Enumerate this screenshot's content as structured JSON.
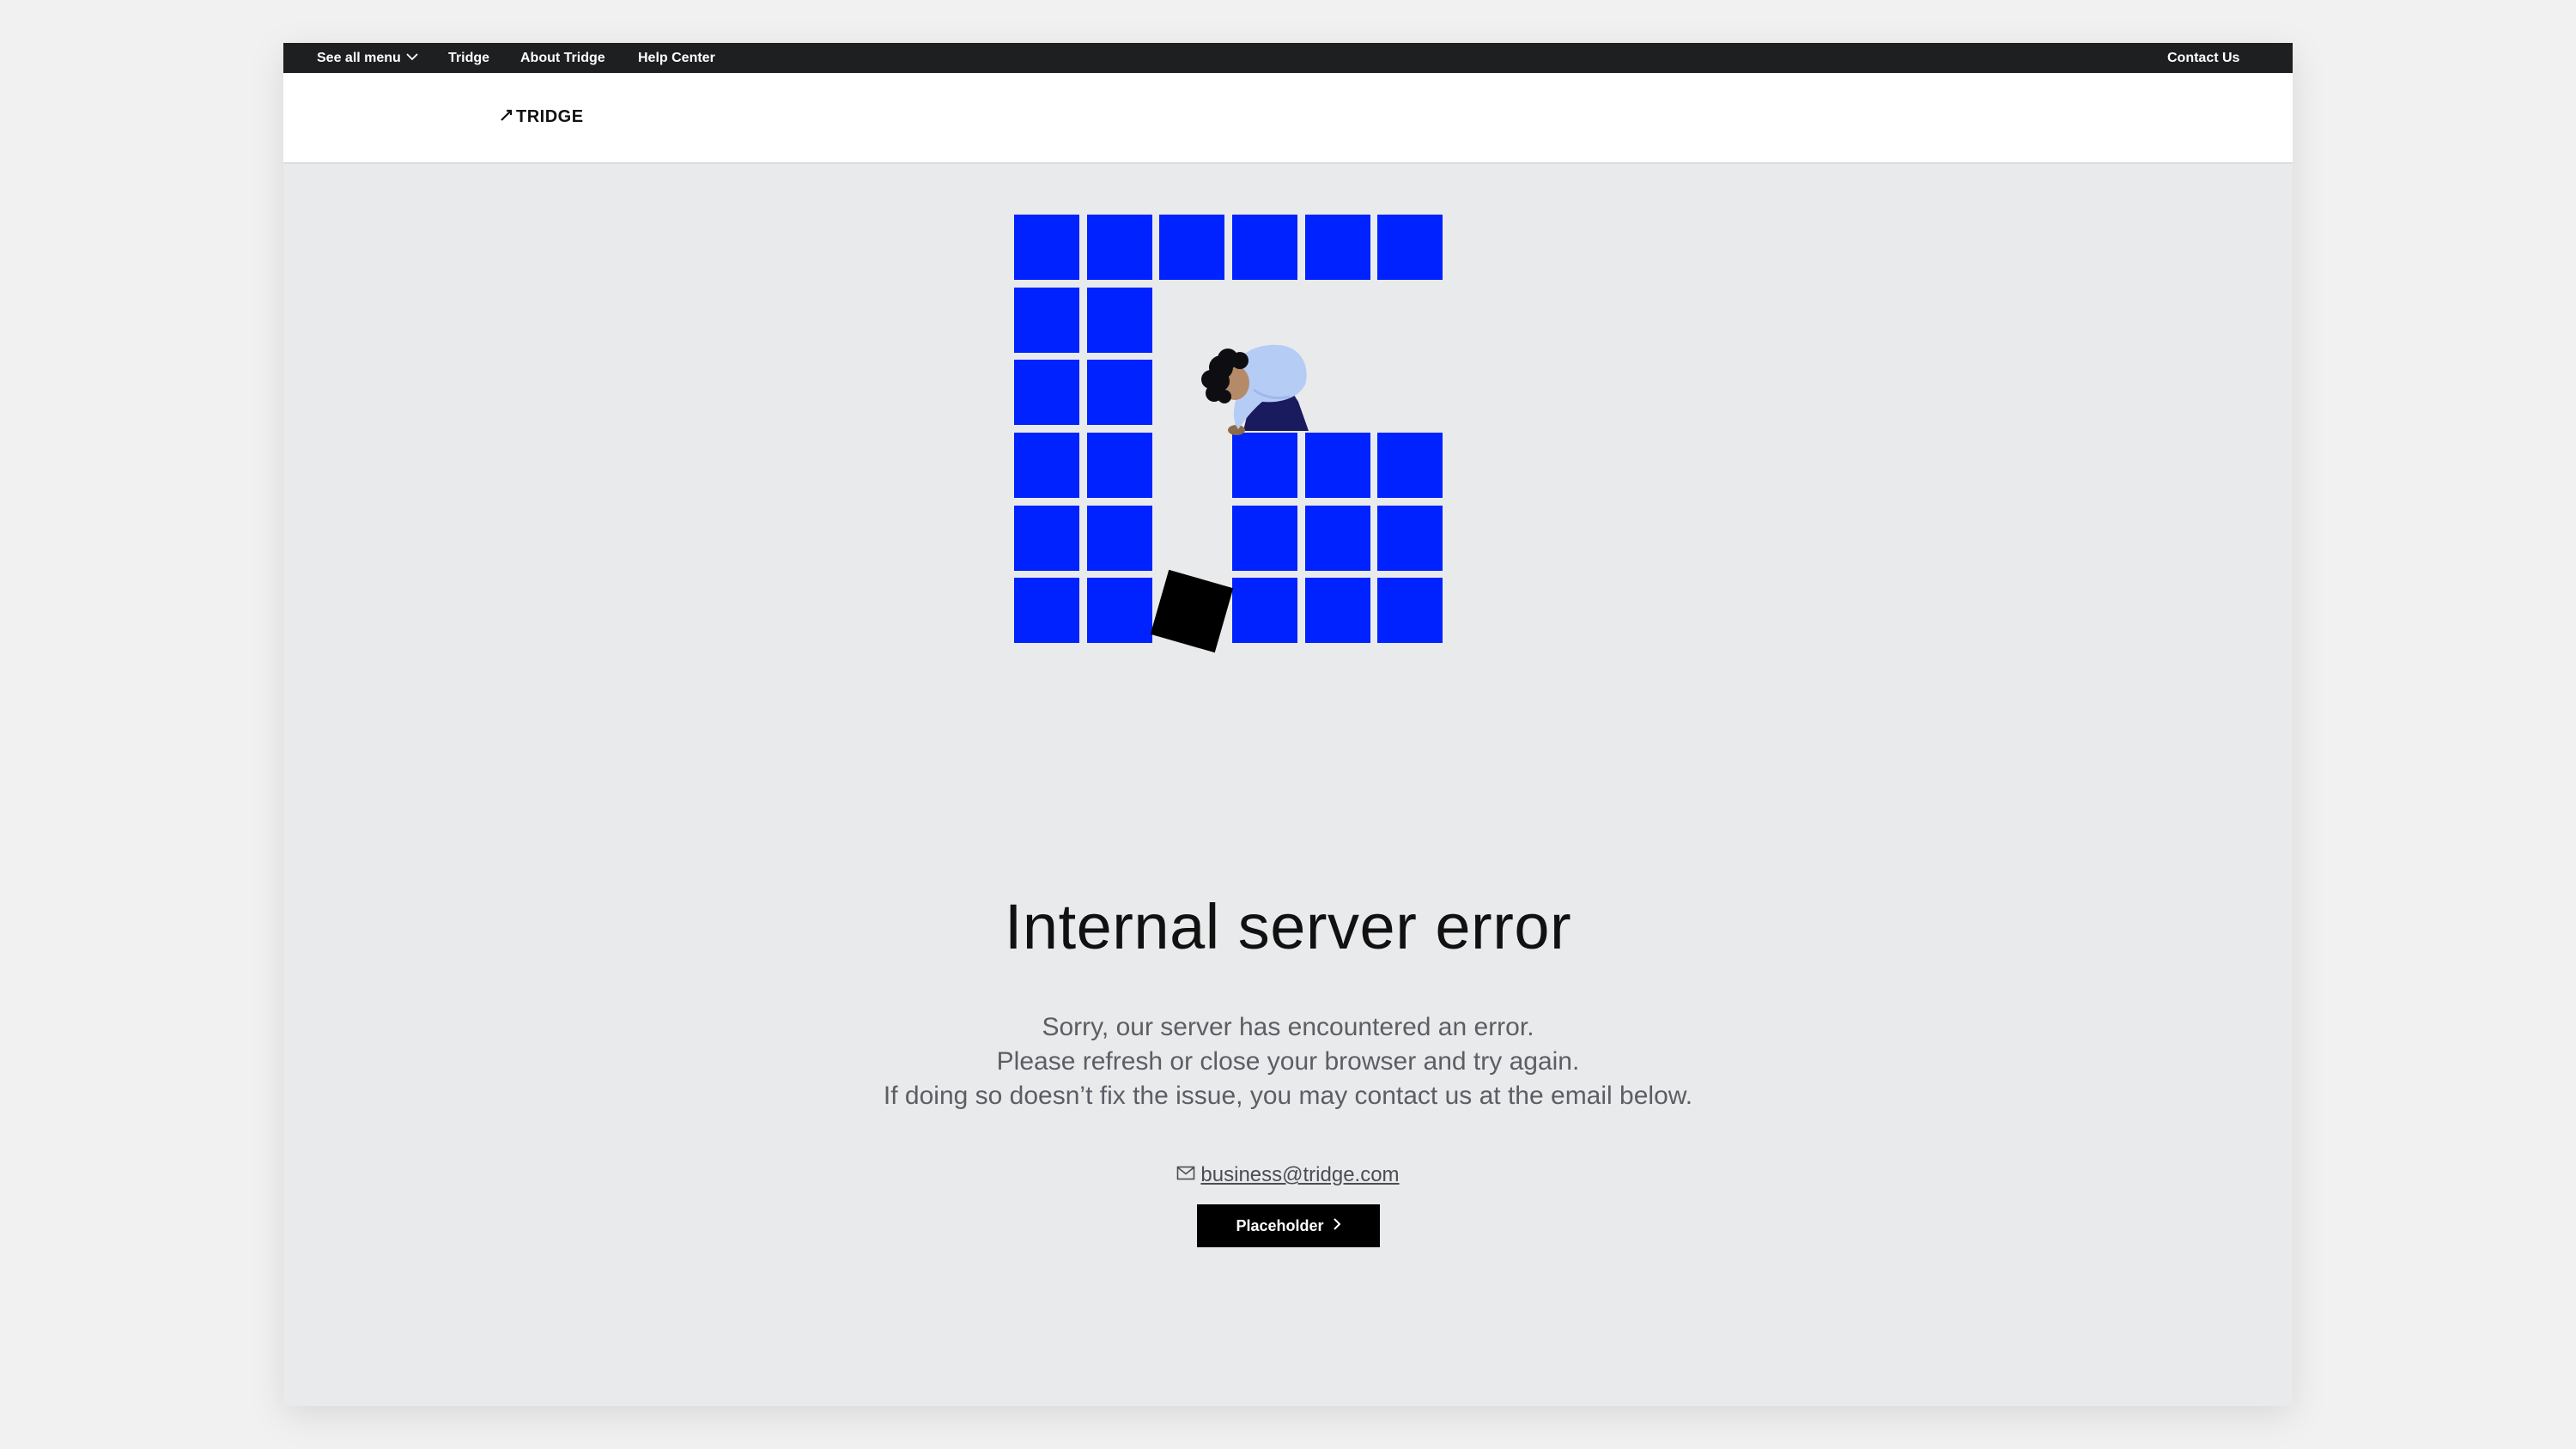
{
  "topbar": {
    "menu_label": "See all menu",
    "links": [
      "Tridge",
      "About Tridge",
      "Help Center"
    ],
    "contact_label": "Contact Us"
  },
  "header": {
    "logo_text": "TRIDGE"
  },
  "main": {
    "title": "Internal server error",
    "description": [
      "Sorry, our server has encountered an error.",
      "Please refresh or close your browser and try again.",
      "If doing so doesn’t fix the issue, you may contact us at the email below."
    ],
    "email": "business@tridge.com",
    "button_label": "Placeholder"
  },
  "colors": {
    "topbar_bg": "#1d1f21",
    "page_bg": "#e9eaeb",
    "block_blue": "#0022ff",
    "button_bg": "#000000",
    "text_primary": "#111111",
    "text_secondary": "#5b5f64"
  },
  "icons": [
    "chevron-down-icon",
    "tridge-logo-icon",
    "mail-icon",
    "chevron-right-icon"
  ]
}
